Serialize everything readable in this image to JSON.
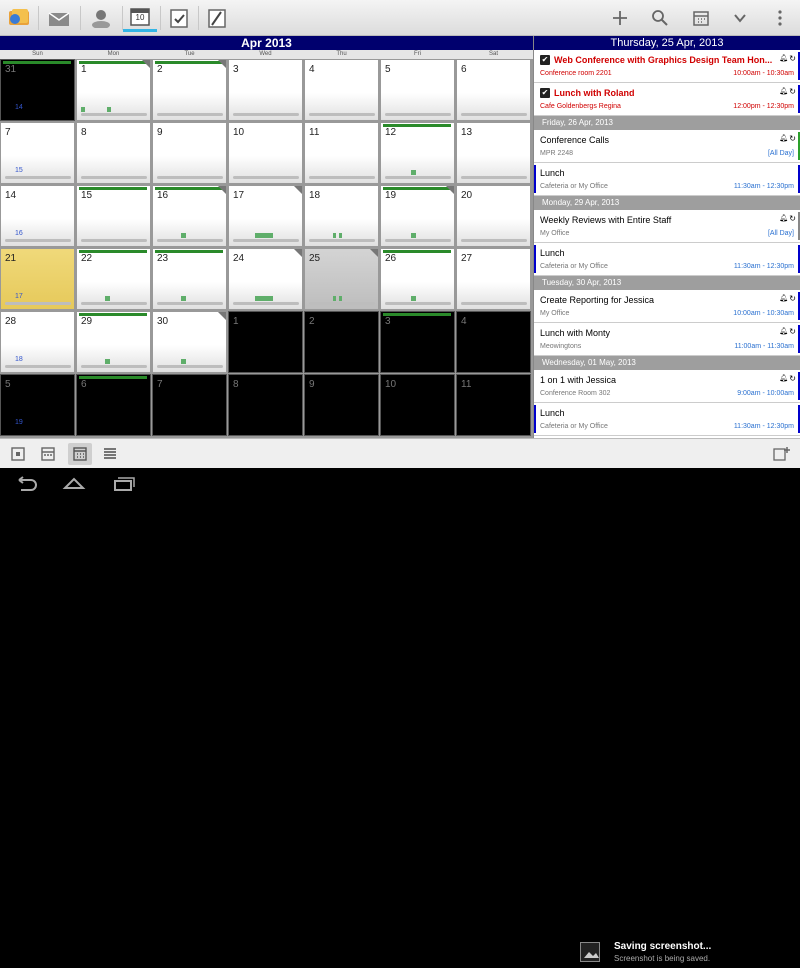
{
  "actionbar": {
    "tabs": [
      "app-menu",
      "mail",
      "contacts",
      "calendar",
      "tasks",
      "notes"
    ],
    "calendar_tab_label": "10",
    "actions": [
      "add",
      "search",
      "go-to-date",
      "more-dropdown",
      "overflow"
    ]
  },
  "month": {
    "title": "Apr 2013",
    "dow": [
      "Sun",
      "Mon",
      "Tue",
      "Wed",
      "Thu",
      "Fri",
      "Sat"
    ],
    "weeks": [
      {
        "week": "14",
        "days": [
          "31",
          "1",
          "2",
          "3",
          "4",
          "5",
          "6"
        ]
      },
      {
        "week": "15",
        "days": [
          "7",
          "8",
          "9",
          "10",
          "11",
          "12",
          "13"
        ]
      },
      {
        "week": "16",
        "days": [
          "14",
          "15",
          "16",
          "17",
          "18",
          "19",
          "20"
        ]
      },
      {
        "week": "17",
        "days": [
          "21",
          "22",
          "23",
          "24",
          "25",
          "26",
          "27"
        ]
      },
      {
        "week": "18",
        "days": [
          "28",
          "29",
          "30",
          "1",
          "2",
          "3",
          "4"
        ]
      },
      {
        "week": "19",
        "days": [
          "5",
          "6",
          "7",
          "8",
          "9",
          "10",
          "11"
        ]
      }
    ]
  },
  "agenda": {
    "header": "Thursday, 25 Apr, 2013",
    "groups": [
      {
        "section": "",
        "items": [
          {
            "title": "Web Conference with Graphics Design Team Hon...",
            "location": "Conference room 2201",
            "time": "10:00am - 10:30am",
            "style": "red",
            "checked": true,
            "stripe": "#0000cc"
          },
          {
            "title": "Lunch with Roland",
            "location": "Cafe Goldenbergs Regina",
            "time": "12:00pm - 12:30pm",
            "style": "red",
            "checked": true,
            "stripe": "#0000cc"
          }
        ]
      },
      {
        "section": "Friday, 26 Apr, 2013",
        "items": [
          {
            "title": "Conference Calls",
            "location": "MPR 2248",
            "time": "[All Day]",
            "style": "normal",
            "checked": false,
            "stripe": "#2ca02c"
          },
          {
            "title": "Lunch",
            "location": "Cafeteria or My Office",
            "time": "11:30am - 12:30pm",
            "style": "normal",
            "checked": false,
            "stripe": "#0000cc",
            "left": true
          }
        ]
      },
      {
        "section": "Monday, 29 Apr, 2013",
        "items": [
          {
            "title": "Weekly Reviews with Entire Staff",
            "location": "My Office",
            "time": "[All Day]",
            "style": "normal",
            "checked": false,
            "stripe": "#888888"
          },
          {
            "title": "Lunch",
            "location": "Cafeteria or My Office",
            "time": "11:30am - 12:30pm",
            "style": "normal",
            "checked": false,
            "stripe": "#0000cc",
            "left": true
          }
        ]
      },
      {
        "section": "Tuesday, 30 Apr, 2013",
        "items": [
          {
            "title": "Create Reporting for Jessica",
            "location": "My Office",
            "time": "10:00am - 10:30am",
            "style": "normal",
            "checked": false,
            "stripe": "#0000cc"
          },
          {
            "title": "Lunch with Monty",
            "location": "Meowingtons",
            "time": "11:00am - 11:30am",
            "style": "normal",
            "checked": false,
            "stripe": "#0000cc"
          }
        ]
      },
      {
        "section": "Wednesday, 01 May, 2013",
        "items": [
          {
            "title": "1 on 1 with Jessica",
            "location": "Conference Room 302",
            "time": "9:00am - 10:00am",
            "style": "normal",
            "checked": false,
            "stripe": "#0000cc"
          },
          {
            "title": "Lunch",
            "location": "Cafeteria or My Office",
            "time": "11:30am - 12:30pm",
            "style": "normal",
            "checked": false,
            "stripe": "#0000cc",
            "left": true
          }
        ]
      }
    ]
  },
  "bottom": {
    "views": [
      "day-view",
      "week-view",
      "month-view",
      "agenda-view"
    ],
    "active": "month-view"
  },
  "toast": {
    "title": "Saving screenshot...",
    "subtitle": "Screenshot is being saved."
  },
  "colors": {
    "header_blue": "#00006e",
    "accent": "#33b5e5",
    "event_green": "#5fae6a",
    "alert_red": "#d00000",
    "today_yellow": "#e6c95a"
  }
}
